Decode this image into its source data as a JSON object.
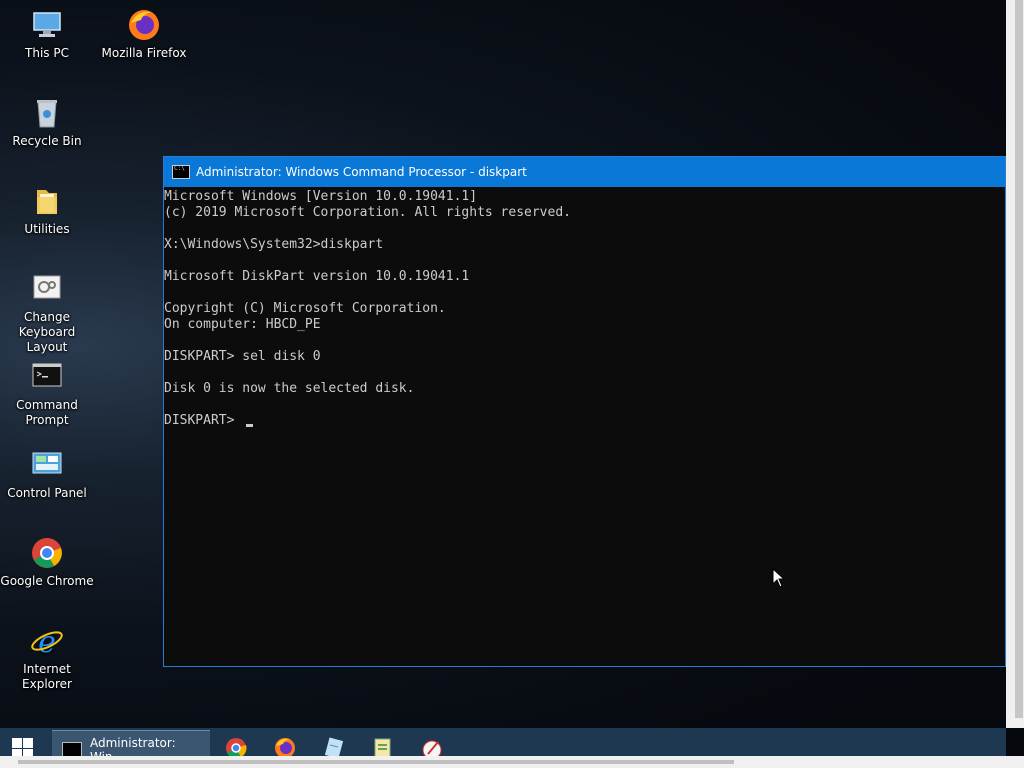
{
  "desktop_icons": [
    {
      "label": "This PC",
      "icon": "computer-icon"
    },
    {
      "label": "Mozilla Firefox",
      "icon": "firefox-icon"
    },
    {
      "label": "Recycle Bin",
      "icon": "recycle-bin-icon"
    },
    {
      "label": "Utilities",
      "icon": "folder-icon"
    },
    {
      "label": "Change Keyboard Layout",
      "icon": "keyboard-settings-icon"
    },
    {
      "label": "Command Prompt",
      "icon": "cmd-icon"
    },
    {
      "label": "Control Panel",
      "icon": "control-panel-icon"
    },
    {
      "label": "Google Chrome",
      "icon": "chrome-icon"
    },
    {
      "label": "Internet Explorer",
      "icon": "ie-icon"
    }
  ],
  "window": {
    "title": "Administrator: Windows Command Processor - diskpart",
    "lines": [
      "Microsoft Windows [Version 10.0.19041.1]",
      "(c) 2019 Microsoft Corporation. All rights reserved.",
      "",
      "X:\\Windows\\System32>diskpart",
      "",
      "Microsoft DiskPart version 10.0.19041.1",
      "",
      "Copyright (C) Microsoft Corporation.",
      "On computer: HBCD_PE",
      "",
      "DISKPART> sel disk 0",
      "",
      "Disk 0 is now the selected disk.",
      "",
      "DISKPART> "
    ]
  },
  "taskbar": {
    "active_task_label": "Administrator: Win...",
    "pinned": [
      "chrome-icon",
      "firefox-icon",
      "notepad-icon",
      "editor-icon",
      "paint-icon"
    ]
  },
  "colors": {
    "titlebar": "#0a78d7",
    "console_bg": "#0c0c0c",
    "console_text": "#cccccc",
    "taskbar": "#1f3852"
  }
}
